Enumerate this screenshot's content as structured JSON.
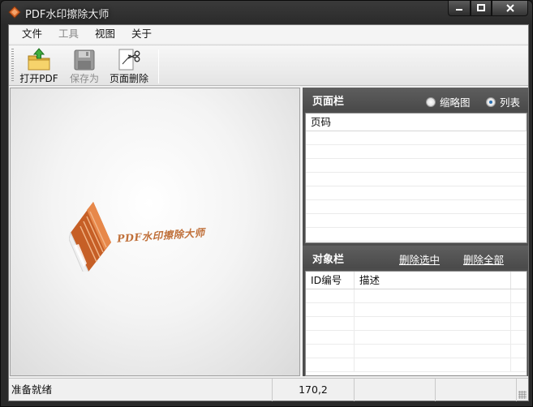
{
  "window": {
    "title": "PDF水印擦除大师"
  },
  "menu": [
    {
      "label": "文件",
      "disabled": false
    },
    {
      "label": "工具",
      "disabled": true
    },
    {
      "label": "视图",
      "disabled": false
    },
    {
      "label": "关于",
      "disabled": false
    }
  ],
  "toolbar": {
    "open_label": "打开PDF",
    "save_label": "保存为",
    "delete_page_label": "页面删除"
  },
  "preview": {
    "logo_text": "PDF水印擦除大师"
  },
  "page_panel": {
    "title": "页面栏",
    "view_thumbnail": "缩略图",
    "view_list": "列表",
    "selected_view": "列表",
    "columns": [
      "页码"
    ]
  },
  "object_panel": {
    "title": "对象栏",
    "delete_selected": "删除选中",
    "delete_all": "删除全部",
    "columns": [
      "ID编号",
      "描述"
    ]
  },
  "status": {
    "message": "准备就绪",
    "coords": "170,2"
  },
  "colors": {
    "logo_orange": "#c0703a",
    "panel_gray": "#4d4d4d",
    "title_bar": "#2a2a2a"
  }
}
